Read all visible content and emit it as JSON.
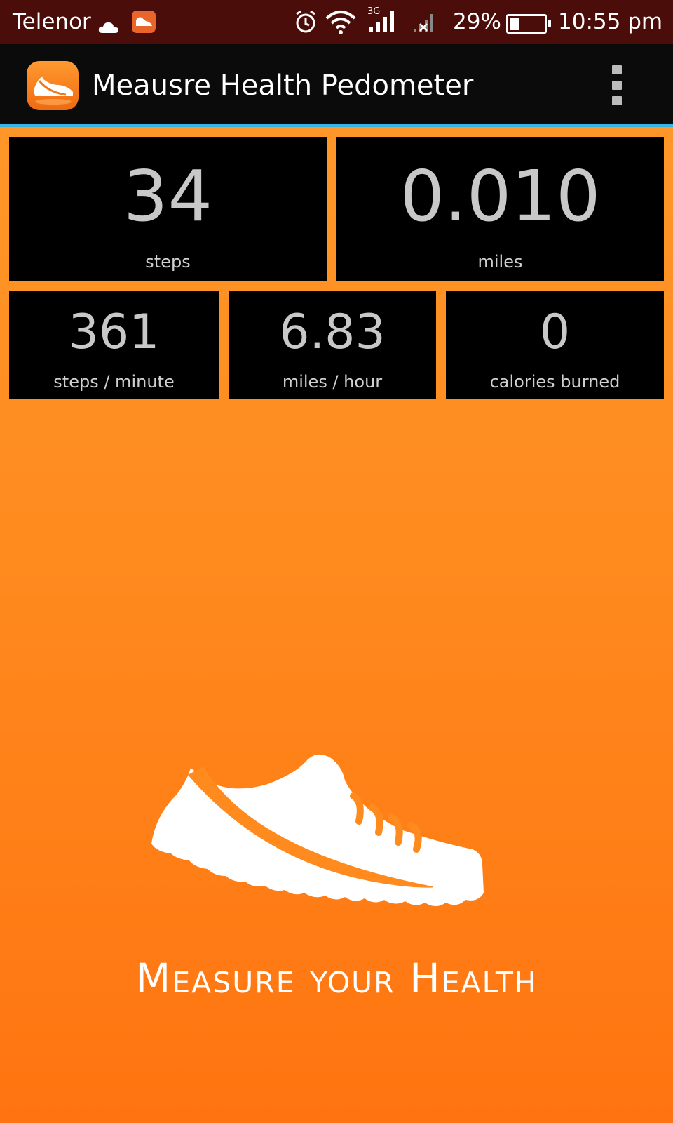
{
  "status_bar": {
    "carrier": "Telenor",
    "network_type": "3G",
    "battery_percent": "29%",
    "battery_level": 0.29,
    "time": "10:55 pm"
  },
  "action_bar": {
    "title": "Meausre Health Pedometer"
  },
  "stats": {
    "steps": {
      "value": "34",
      "label": "steps"
    },
    "miles": {
      "value": "0.010",
      "label": "miles"
    },
    "steps_per_minute": {
      "value": "361",
      "label": "steps / minute"
    },
    "miles_per_hour": {
      "value": "6.83",
      "label": "miles / hour"
    },
    "calories": {
      "value": "0",
      "label": "calories burned"
    }
  },
  "tagline": "Measure your Health",
  "colors": {
    "status_bar": "#4a0d0a",
    "action_bar": "#0b0b0b",
    "accent_line": "#33b5e5",
    "background_orange": "#ff8a1e",
    "tile_bg": "#000000"
  }
}
